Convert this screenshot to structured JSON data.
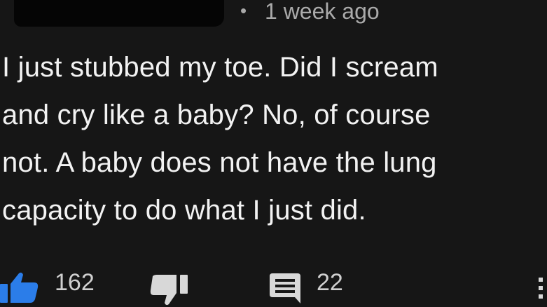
{
  "comment": {
    "meta": {
      "separator": "•",
      "time_ago": "1 week ago"
    },
    "text": "I just stubbed my toe. Did I scream\nand cry like a baby? No, of course\nnot. A baby does not have the lung\ncapacity to do what I just did.",
    "actions": {
      "like_icon": "thumbs-up-icon",
      "like_count": "162",
      "dislike_icon": "thumbs-down-icon",
      "reply_icon": "comment-icon",
      "reply_count": "22",
      "more_icon": "more-vertical-icon"
    }
  },
  "colors": {
    "background": "#161616",
    "text": "#f2f2f2",
    "meta_text": "#aaaaaa",
    "like_blue": "#2b7de9",
    "icon_gray": "#d8d8d8"
  }
}
